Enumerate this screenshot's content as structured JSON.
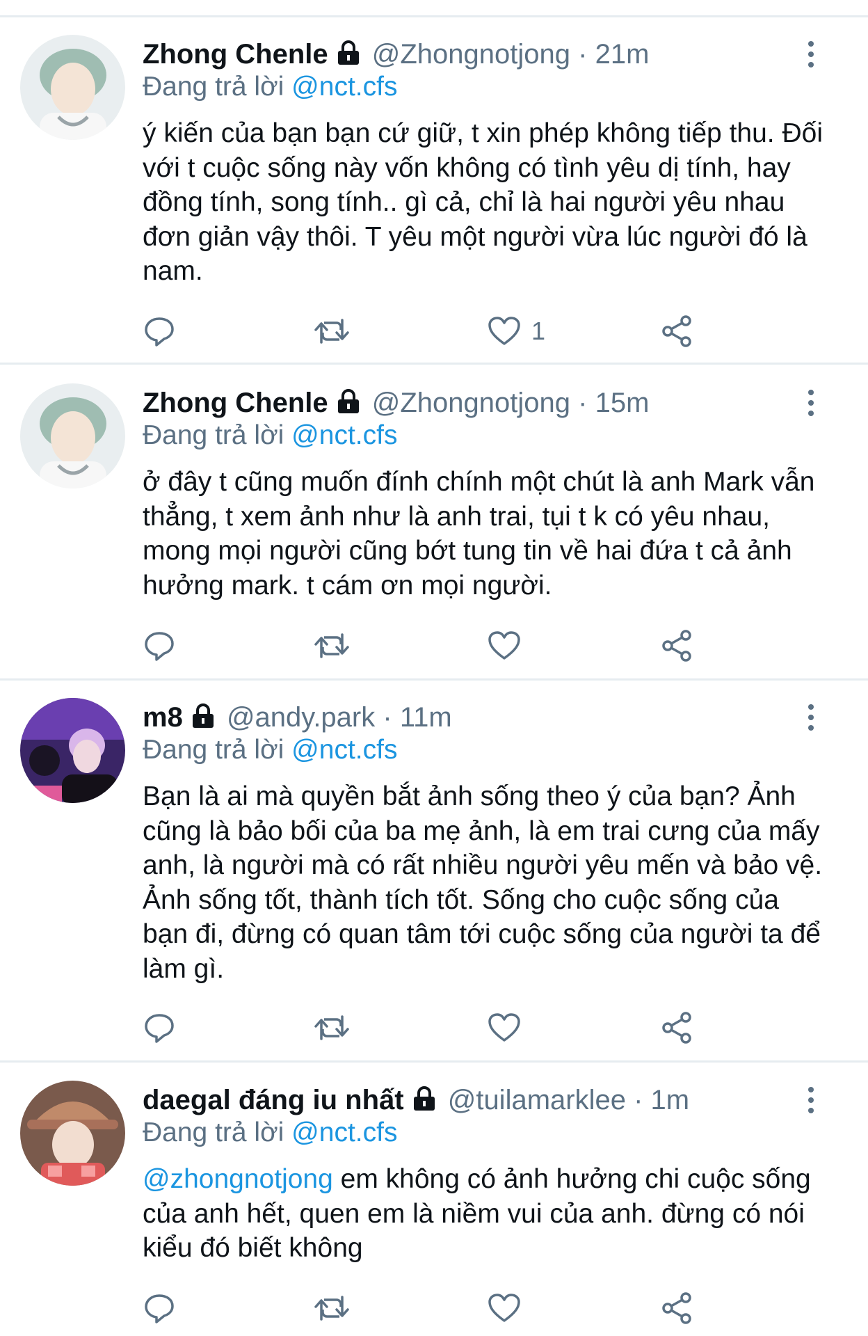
{
  "replying_prefix": "Đang trả lời",
  "tweets": [
    {
      "name": "Zhong Chenle",
      "handle": "@Zhongnotjong",
      "separator": "·",
      "time": "21m",
      "replying_to": "@nct.cfs",
      "mention": "",
      "text": "ý kiến của bạn bạn cứ giữ, t xin phép không tiếp thu. Đối với t cuộc sống này vốn không có tình yêu dị tính, hay đồng tính, song tính.. gì cả, chỉ là hai người yêu nhau đơn giản vậy thôi. T yêu một người vừa lúc người đó là nam.",
      "like_count": "1",
      "avatar_colors": [
        "#c9d8cf",
        "#8fb3a8",
        "#f3e6dc"
      ]
    },
    {
      "name": "Zhong Chenle",
      "handle": "@Zhongnotjong",
      "separator": "·",
      "time": "15m",
      "replying_to": "@nct.cfs",
      "mention": "",
      "text": "ở đây t cũng muốn đính chính một chút là anh Mark vẫn thẳng, t xem ảnh như là anh trai, tụi t k có yêu nhau, mong mọi người cũng bớt tung tin về hai đứa t cả ảnh hưởng mark. t cám ơn mọi người.",
      "like_count": "",
      "avatar_colors": [
        "#c9d8cf",
        "#8fb3a8",
        "#f3e6dc"
      ]
    },
    {
      "name": "m8",
      "handle": "@andy.park",
      "separator": "·",
      "time": "11m",
      "replying_to": "@nct.cfs",
      "mention": "",
      "text": "Bạn là ai mà quyền bắt ảnh sống theo ý của bạn? Ảnh cũng là bảo bối của ba mẹ ảnh, là em trai cưng của mấy anh, là người mà có rất nhiều người yêu mến và bảo vệ. Ảnh sống tốt, thành tích tốt. Sống cho cuộc sống của bạn đi, đừng có quan tâm tới cuộc sống của người ta để làm gì.",
      "like_count": "",
      "avatar_colors": [
        "#6a3fb0",
        "#2b1d4a",
        "#d68ae0"
      ]
    },
    {
      "name": "daegal đáng iu nhất",
      "handle": "@tuilamarklee",
      "separator": "·",
      "time": "1m",
      "replying_to": "@nct.cfs",
      "mention": "@zhongnotjong",
      "text": " em không có ảnh hưởng chi cuộc sống của anh hết, quen em là niềm vui của anh. đừng có nói kiểu đó biết không",
      "like_count": "",
      "avatar_colors": [
        "#a8705a",
        "#5a3a30",
        "#e05a5a"
      ]
    }
  ]
}
